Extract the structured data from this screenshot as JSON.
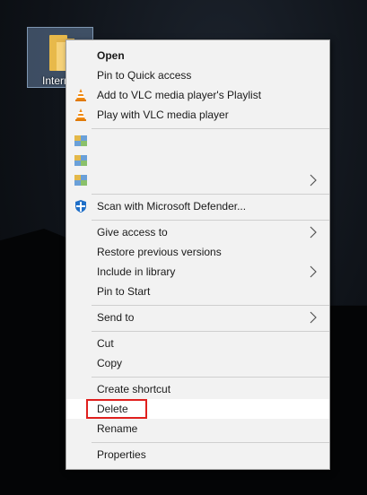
{
  "desktop": {
    "folder_label": "Intern"
  },
  "menu": {
    "items": [
      {
        "label": "Open",
        "icon": "none",
        "submenu": false
      },
      {
        "label": "Pin to Quick access",
        "icon": "none",
        "submenu": false
      },
      {
        "label": "Add to VLC media player's Playlist",
        "icon": "vlc-cone-icon",
        "submenu": false
      },
      {
        "label": "Play with VLC media player",
        "icon": "vlc-cone-icon",
        "submenu": false
      },
      {
        "label": "",
        "icon": "archive-icon",
        "submenu": false
      },
      {
        "label": "",
        "icon": "archive-icon",
        "submenu": false
      },
      {
        "label": "",
        "icon": "archive-icon",
        "submenu": true
      },
      {
        "label": "Scan with Microsoft Defender...",
        "icon": "defender-shield-icon",
        "submenu": false
      },
      {
        "label": "Give access to",
        "icon": "none",
        "submenu": true
      },
      {
        "label": "Restore previous versions",
        "icon": "none",
        "submenu": false
      },
      {
        "label": "Include in library",
        "icon": "none",
        "submenu": true
      },
      {
        "label": "Pin to Start",
        "icon": "none",
        "submenu": false
      },
      {
        "label": "Send to",
        "icon": "none",
        "submenu": true
      },
      {
        "label": "Cut",
        "icon": "none",
        "submenu": false
      },
      {
        "label": "Copy",
        "icon": "none",
        "submenu": false
      },
      {
        "label": "Create shortcut",
        "icon": "none",
        "submenu": false
      },
      {
        "label": "Delete",
        "icon": "none",
        "submenu": false
      },
      {
        "label": "Rename",
        "icon": "none",
        "submenu": false
      },
      {
        "label": "Properties",
        "icon": "none",
        "submenu": false
      }
    ],
    "highlighted_item": "Delete",
    "highlight_color": "#e0201e"
  }
}
